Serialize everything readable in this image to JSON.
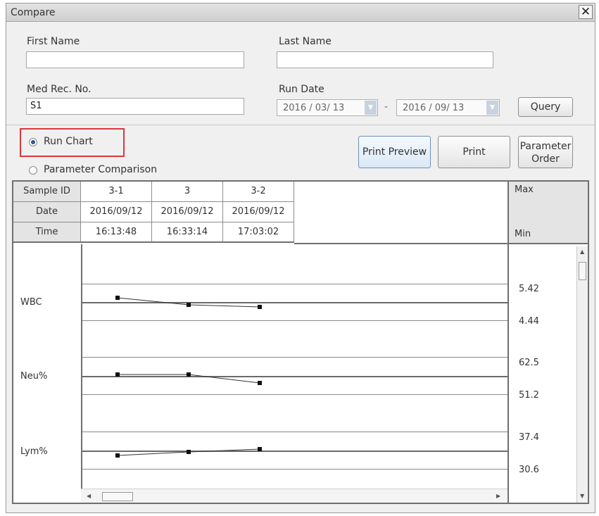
{
  "window": {
    "title": "Compare",
    "close_glyph": "✕"
  },
  "form": {
    "first_name_label": "First Name",
    "first_name_value": "",
    "last_name_label": "Last Name",
    "last_name_value": "",
    "med_rec_label": "Med Rec. No.",
    "med_rec_value": "S1",
    "run_date_label": "Run Date",
    "date_from": "2016 / 03/ 13",
    "date_sep": "-",
    "date_to": "2016 / 09/ 13",
    "query_label": "Query"
  },
  "view": {
    "run_chart_label": "Run Chart",
    "param_comparison_label": "Parameter Comparison",
    "selected": "Run Chart"
  },
  "actions": {
    "print_preview": "Print Preview",
    "print": "Print",
    "parameter_order_line1": "Parameter",
    "parameter_order_line2": "Order"
  },
  "table": {
    "row_headers": [
      "Sample ID",
      "Date",
      "Time"
    ],
    "samples": [
      {
        "id": "3-1",
        "date": "2016/09/12",
        "time": "16:13:48"
      },
      {
        "id": "3",
        "date": "2016/09/12",
        "time": "16:33:14"
      },
      {
        "id": "3-2",
        "date": "2016/09/12",
        "time": "17:03:02"
      }
    ],
    "max_label": "Max",
    "min_label": "Min"
  },
  "parameters": [
    {
      "name": "WBC",
      "max": "5.42",
      "min": "4.44"
    },
    {
      "name": "Neu%",
      "max": "62.5",
      "min": "51.2"
    },
    {
      "name": "Lym%",
      "max": "37.4",
      "min": "30.6"
    }
  ],
  "icons": {
    "scroll_up": "▲",
    "scroll_down": "▼",
    "scroll_left": "◀",
    "scroll_right": "▶",
    "dropdown": "▼"
  }
}
